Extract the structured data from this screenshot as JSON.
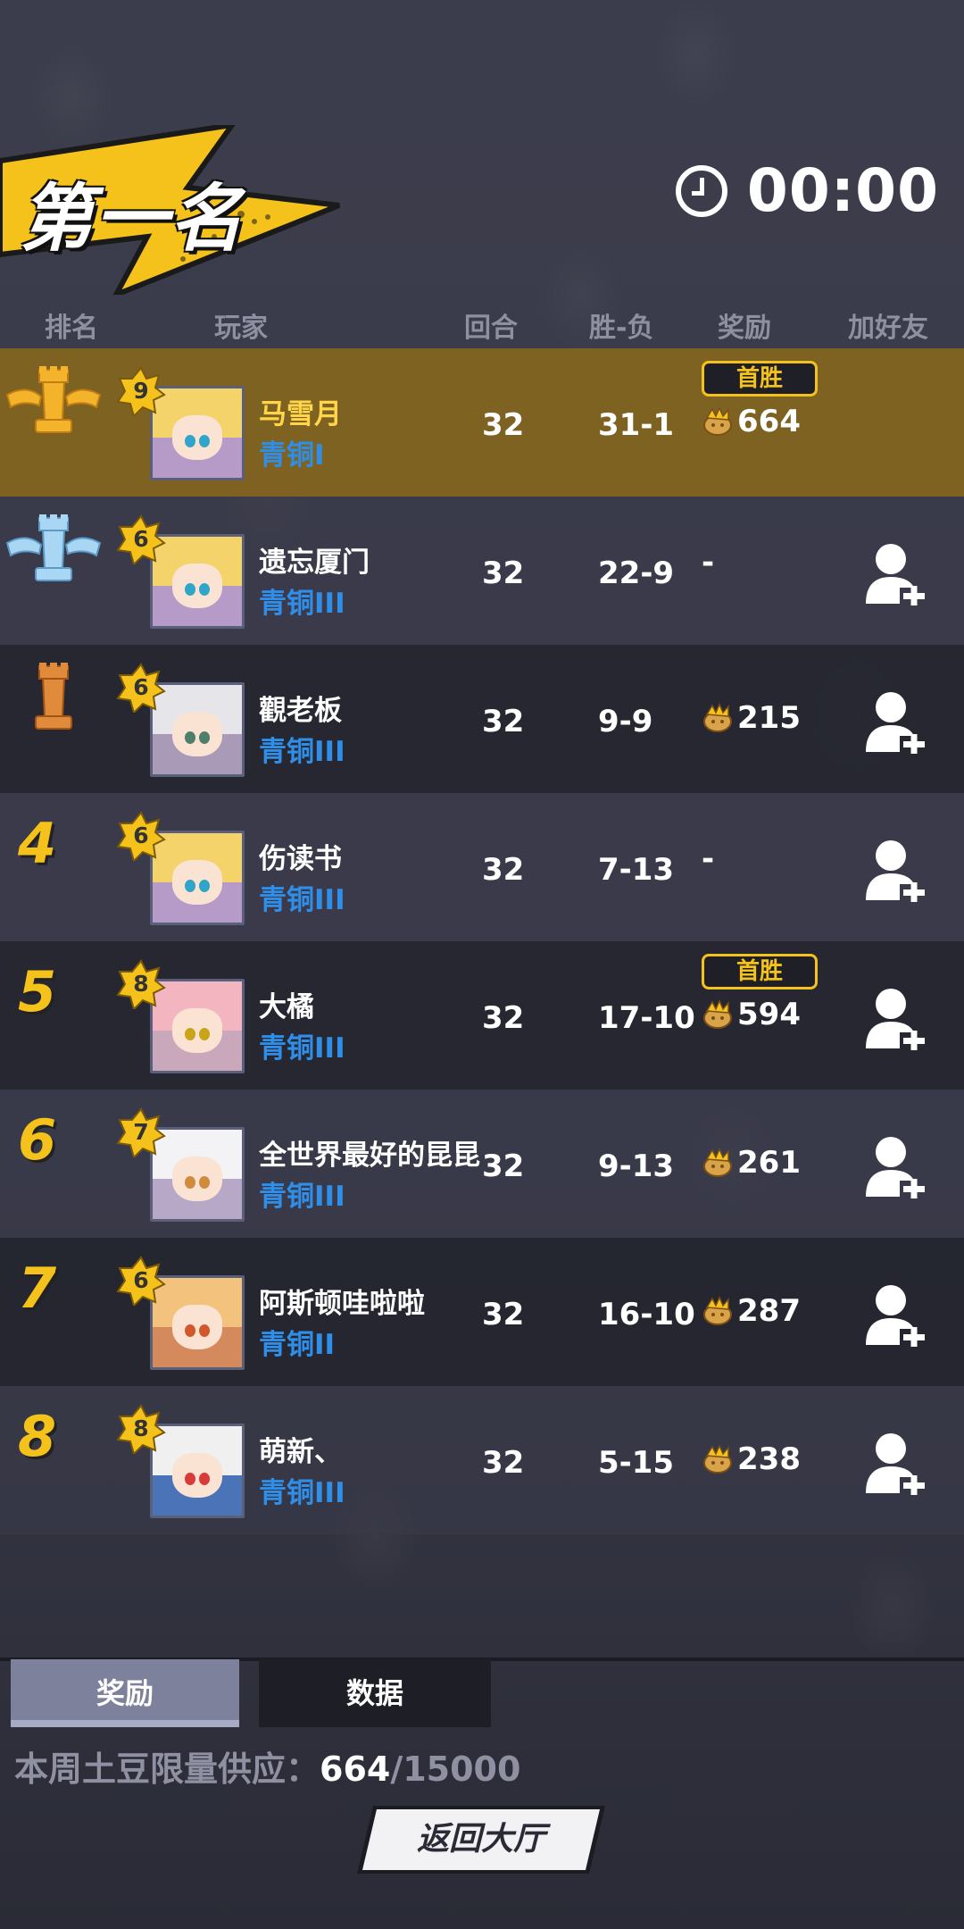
{
  "banner": {
    "title": "第一名"
  },
  "timer": {
    "time": "00:00",
    "icon": "clock-icon"
  },
  "columns": [
    "排名",
    "玩家",
    "回合",
    "胜-负",
    "奖励",
    "加好友"
  ],
  "first_win_label": "首胜",
  "rows": [
    {
      "rank": "1",
      "level": "9",
      "name": "马雪月",
      "tier": "青铜I",
      "rounds": "32",
      "wl": "31-1",
      "reward": "664",
      "first_win": true,
      "avatar": "blonde-cat-ears"
    },
    {
      "rank": "2",
      "level": "6",
      "name": "遗忘厦门",
      "tier": "青铜III",
      "rounds": "32",
      "wl": "22-9",
      "reward": "-",
      "first_win": false,
      "avatar": "blonde-cat-ears"
    },
    {
      "rank": "3",
      "level": "6",
      "name": "觀老板",
      "tier": "青铜III",
      "rounds": "32",
      "wl": "9-9",
      "reward": "215",
      "first_win": false,
      "avatar": "silver-hair-boy"
    },
    {
      "rank": "4",
      "level": "6",
      "name": "伤读书",
      "tier": "青铜III",
      "rounds": "32",
      "wl": "7-13",
      "reward": "-",
      "first_win": false,
      "avatar": "blonde-cat-ears"
    },
    {
      "rank": "5",
      "level": "8",
      "name": "大橘",
      "tier": "青铜III",
      "rounds": "32",
      "wl": "17-10",
      "reward": "594",
      "first_win": true,
      "avatar": "pink-mask"
    },
    {
      "rank": "6",
      "level": "7",
      "name": "全世界最好的昆昆",
      "tier": "青铜III",
      "rounds": "32",
      "wl": "9-13",
      "reward": "261",
      "first_win": false,
      "avatar": "white-hair-girl"
    },
    {
      "rank": "7",
      "level": "6",
      "name": "阿斯顿哇啦啦",
      "tier": "青铜II",
      "rounds": "32",
      "wl": "16-10",
      "reward": "287",
      "first_win": false,
      "avatar": "orange-hair-girl"
    },
    {
      "rank": "8",
      "level": "8",
      "name": "萌新、",
      "tier": "青铜III",
      "rounds": "32",
      "wl": "5-15",
      "reward": "238",
      "first_win": false,
      "avatar": "white-hair-blue"
    }
  ],
  "tabs": {
    "reward": "奖励",
    "data": "数据"
  },
  "supply": {
    "label": "本周土豆限量供应：",
    "current": "664",
    "limit": "/15000"
  },
  "back_button": "返回大厅",
  "colors": {
    "gold": "#f5c21b",
    "tier_blue": "#2f8ee8",
    "first_row": "#8b681a"
  }
}
